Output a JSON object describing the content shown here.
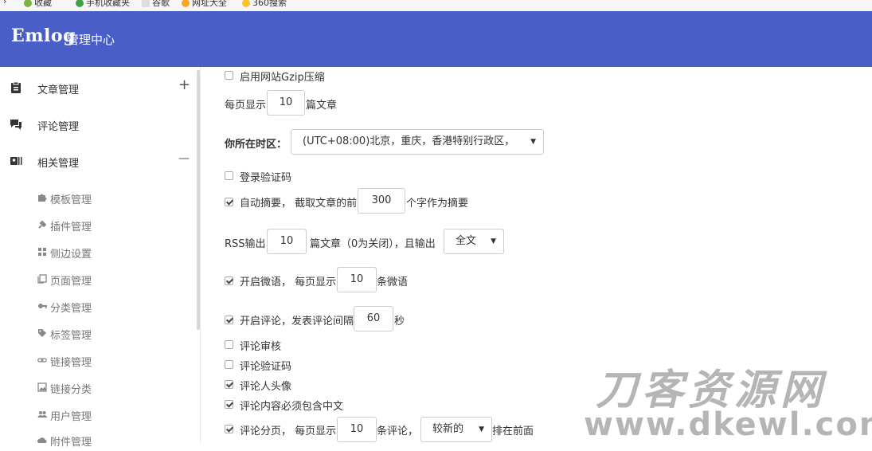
{
  "bookmarks": [
    {
      "label": "收藏"
    },
    {
      "label": "手机收藏夹"
    },
    {
      "label": "谷歌"
    },
    {
      "label": "网址大全"
    },
    {
      "label": "360搜索"
    }
  ],
  "header": {
    "logo": "Emlog",
    "subtitle": "管理中心"
  },
  "sidebar": {
    "menu": [
      {
        "label": "文章管理",
        "toggle": "+"
      },
      {
        "label": "评论管理"
      },
      {
        "label": "相关管理",
        "toggle": "—"
      }
    ],
    "sub": [
      {
        "label": "模板管理"
      },
      {
        "label": "插件管理"
      },
      {
        "label": "侧边设置"
      },
      {
        "label": "页面管理"
      },
      {
        "label": "分类管理"
      },
      {
        "label": "标签管理"
      },
      {
        "label": "链接管理"
      },
      {
        "label": "链接分类"
      },
      {
        "label": "用户管理"
      },
      {
        "label": "附件管理"
      }
    ]
  },
  "settings": {
    "gzip": {
      "label": "启用网站Gzip压缩",
      "checked": false
    },
    "per_page": {
      "prefix": "每页显示",
      "value": "10",
      "suffix": "篇文章"
    },
    "timezone": {
      "label": "你所在时区：",
      "value": "(UTC+08:00)北京，重庆，香港特别行政区，"
    },
    "login_captcha": {
      "label": "登录验证码",
      "checked": false
    },
    "excerpt": {
      "label": "自动摘要， 截取文章的前",
      "value": "300",
      "suffix": "个字作为摘要",
      "checked": true
    },
    "rss": {
      "prefix": "RSS输出",
      "value": "10",
      "middle": "篇文章（0为关闭），且输出",
      "select": "全文"
    },
    "twitter": {
      "label": "开启微语， 每页显示",
      "value": "10",
      "suffix": "条微语",
      "checked": true
    },
    "comment": {
      "label": "开启评论，发表评论间隔",
      "value": "60",
      "suffix": "秒",
      "checked": true
    },
    "comment_review": {
      "label": "评论审核",
      "checked": false
    },
    "comment_captcha": {
      "label": "评论验证码",
      "checked": false
    },
    "comment_avatar": {
      "label": "评论人头像",
      "checked": true
    },
    "comment_chinese": {
      "label": "评论内容必须包含中文",
      "checked": true
    },
    "comment_paging": {
      "label": "评论分页， 每页显示",
      "value": "10",
      "middle": "条评论，",
      "select": "较新的",
      "suffix": "排在前面",
      "checked": true
    }
  },
  "watermark": {
    "line1": "刀客资源网",
    "line2": "www.dkewl.com"
  }
}
